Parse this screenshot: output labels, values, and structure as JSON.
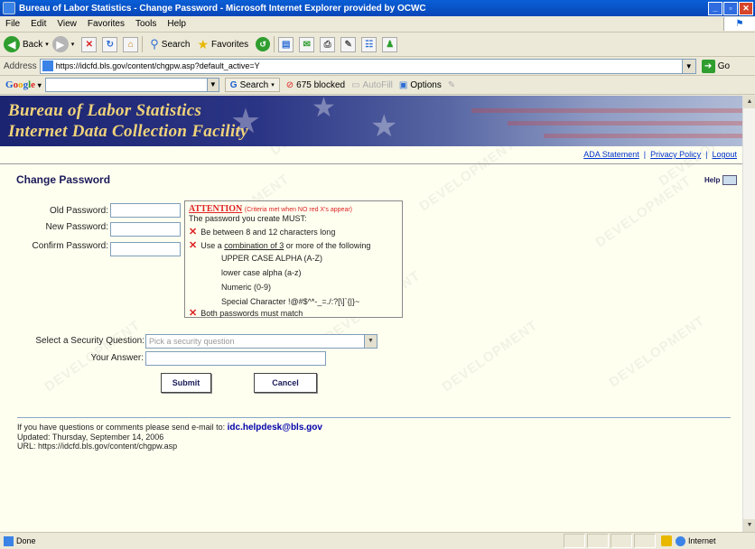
{
  "window": {
    "title": "Bureau of Labor Statistics - Change Password - Microsoft Internet Explorer provided by OCWC"
  },
  "menu": [
    "File",
    "Edit",
    "View",
    "Favorites",
    "Tools",
    "Help"
  ],
  "toolbar": {
    "back": "Back",
    "search": "Search",
    "favorites": "Favorites"
  },
  "address": {
    "label": "Address",
    "url": "https://idcfd.bls.gov/content/chgpw.asp?default_active=Y",
    "go": "Go"
  },
  "google": {
    "logo": "Google",
    "search": "Search",
    "blocked": "675 blocked",
    "autofill": "AutoFill",
    "options": "Options"
  },
  "banner": {
    "line1": "Bureau of Labor Statistics",
    "line2": "Internet Data Collection Facility"
  },
  "toplinks": {
    "ada": "ADA Statement",
    "privacy": "Privacy Policy",
    "logout": "Logout"
  },
  "page": {
    "title": "Change Password",
    "help": "Help"
  },
  "form": {
    "old_label": "Old Password:",
    "new_label": "New Password:",
    "confirm_label": "Confirm Password:",
    "question_label": "Select a Security Question:",
    "question_placeholder": "Pick a security question",
    "answer_label": "Your Answer:",
    "submit": "Submit",
    "cancel": "Cancel"
  },
  "attention": {
    "head": "ATTENTION",
    "criteria": "(Criteria met when NO red X's appear)",
    "intro": "The password you create MUST:",
    "rule1": "Be between 8 and 12 characters long",
    "rule2_pre": "Use a ",
    "rule2_link": "combination of 3",
    "rule2_post": " or more of the following",
    "sub1": "UPPER CASE ALPHA (A-Z)",
    "sub2": "lower case alpha (a-z)",
    "sub3": "Numeric (0-9)",
    "sub4": "Special Character !@#$^*-_=./:?[\\]`{|}~",
    "rule3": "Both passwords must match"
  },
  "watermark": "DEVELOPMENT",
  "footer": {
    "line1": "If you have questions or comments please send e-mail to: ",
    "email": "idc.helpdesk@bls.gov",
    "line2": "Updated: Thursday, September 14, 2006",
    "line3": "URL: https://idcfd.bls.gov/content/chgpw.asp"
  },
  "status": {
    "left": "Done",
    "zone": "Internet"
  }
}
